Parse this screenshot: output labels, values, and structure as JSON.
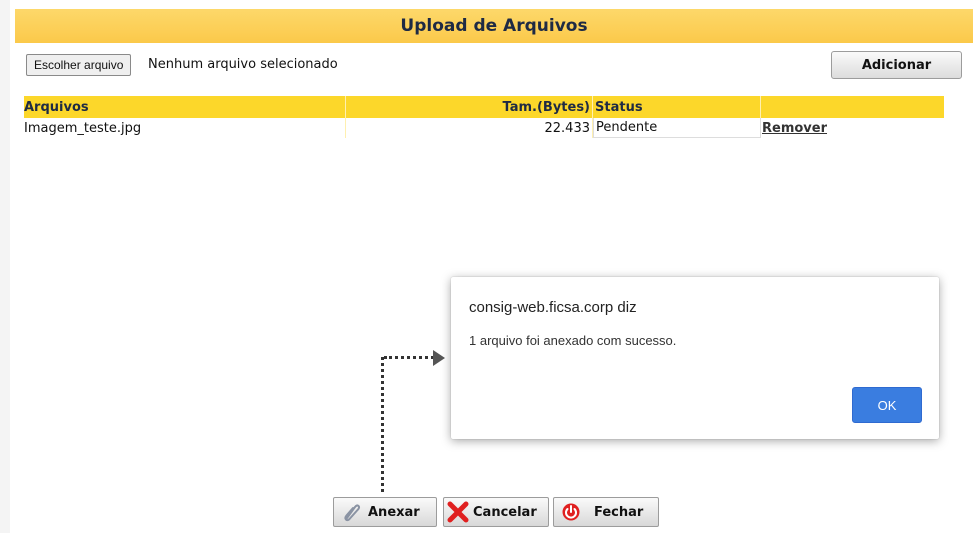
{
  "dialog_window": {
    "title": "Upload de Arquivos"
  },
  "file_picker": {
    "button_label": "Escolher arquivo",
    "status": "Nenhum arquivo selecionado"
  },
  "toolbar": {
    "add_label": "Adicionar"
  },
  "table": {
    "headers": [
      "Arquivos",
      "Tam.(Bytes)",
      "Status",
      ""
    ],
    "rows": [
      {
        "file": "Imagem_teste.jpg",
        "size": "22.433",
        "status": "Pendente",
        "action": "Remover"
      }
    ]
  },
  "alert": {
    "title": "consig-web.ficsa.corp diz",
    "message": "1 arquivo foi anexado com sucesso.",
    "ok_label": "OK"
  },
  "footer": {
    "attach_label": "Anexar",
    "cancel_label": "Cancelar",
    "close_label": "Fechar"
  },
  "colors": {
    "title_bar": "#fbc94a",
    "table_header": "#fcd72a",
    "ok_button": "#3a7de0",
    "cancel_icon": "#e02020",
    "close_icon": "#e02020"
  },
  "icons": [
    "paperclip-icon",
    "cancel-x-icon",
    "power-icon",
    "arrow-right-icon"
  ]
}
